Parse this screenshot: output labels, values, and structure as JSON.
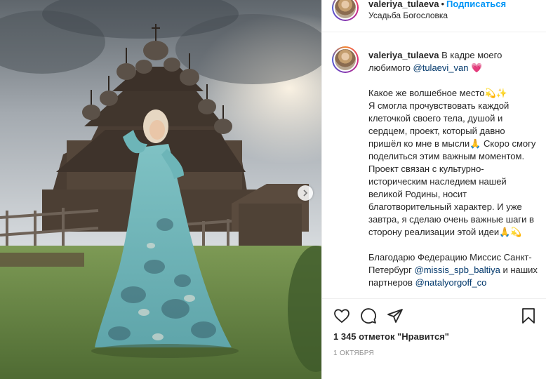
{
  "post": {
    "username": "valeriya_tulaeva",
    "follow_label": "Подписаться",
    "separator": "•",
    "location": "Усадьба Богословка"
  },
  "caption": {
    "username": "valeriya_tulaeva",
    "lead": " В кадре моего любимого ",
    "mention1": "@tulaevi_van",
    "heart": " 💗",
    "body1": "\n\nКакое же волшебное место💫✨\nЯ смогла прочувствовать каждой клеточкой своего тела, душой и сердцем, проект, который давно пришёл ко мне в мысли🙏 Скоро смогу поделиться этим важным моментом.\nПроект связан с культурно-историческим наследием нашей великой Родины, носит благотворительный характер. И уже завтра, я сделаю очень важные шаги в сторону реализации этой идеи🙏💫\n\nБлагодарю Федерацию Миссис Санкт-Петербург ",
    "mention2": "@missis_spb_baltiya",
    "body2": " и наших партнеров ",
    "mention3": "@natalyorgoff_co"
  },
  "actions": {
    "likes": "1 345 отметок \"Нравится\"",
    "date": "1 октября"
  },
  "icons": [
    "heart-icon",
    "comment-icon",
    "share-icon",
    "bookmark-icon",
    "chevron-right-icon"
  ],
  "colors": {
    "link": "#0095f6",
    "mention": "#00376b",
    "muted": "#8e8e8e",
    "border": "#efefef"
  }
}
